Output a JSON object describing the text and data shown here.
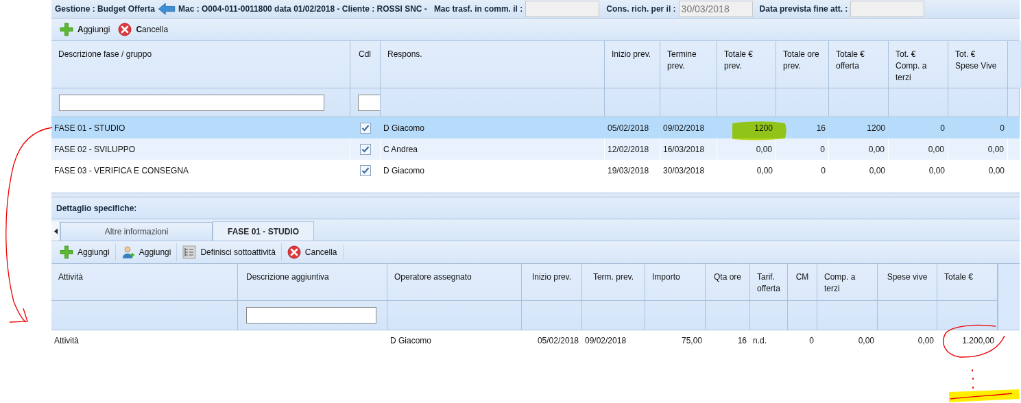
{
  "header": {
    "title": "Gestione : Budget Offerta",
    "info": "Mac : O004-011-0011800 data 01/02/2018 - Cliente : ROSSI SNC -",
    "fields": [
      {
        "label": "Mac trasf. in comm. il :"
      },
      {
        "label": "Cons. rich. per il :",
        "value": "30/03/2018"
      },
      {
        "label": "Data prevista fine att. :"
      }
    ]
  },
  "toolbar": [
    {
      "kind": "add",
      "label": "**A**ggiungi"
    },
    {
      "kind": "delete",
      "label": "**C**ancella"
    }
  ],
  "phases": {
    "columns": [
      {
        "label": "Descrizione fase / gruppo",
        "filter": true
      },
      {
        "label": "Cdl",
        "filter": true
      },
      {
        "label": "Respons."
      },
      {
        "label": "Inizio prev."
      },
      {
        "label": "Termine prev."
      },
      {
        "label": "Totale € prev."
      },
      {
        "label": "Totale ore prev."
      },
      {
        "label": "Totale € offerta"
      },
      {
        "label": "Tot. € Comp. a terzi"
      },
      {
        "label": "Tot. € Spese Vive"
      }
    ],
    "rows": [
      {
        "selected": true,
        "cells": [
          "FASE 01 - STUDIO",
          {
            "checked": true
          },
          "D Giacomo",
          "05/02/2018",
          "09/02/2018",
          "1200",
          "16",
          "1200",
          "0",
          "0"
        ]
      },
      {
        "selected": false,
        "cells": [
          "FASE 02 - SVILUPPO",
          {
            "checked": true
          },
          "C Andrea",
          "12/02/2018",
          "16/03/2018",
          "0,00",
          "0",
          "0,00",
          "0,00",
          "0,00"
        ]
      },
      {
        "selected": false,
        "cells": [
          "FASE 03 - VERIFICA E CONSEGNA",
          {
            "checked": true
          },
          "D Giacomo",
          "19/03/2018",
          "30/03/2018",
          "0,00",
          "0",
          "0,00",
          "0,00",
          "0,00"
        ]
      }
    ]
  },
  "detail": {
    "title": "Dettaglio specifiche:",
    "tabs": [
      {
        "label": "Altre informazioni",
        "selected": false
      },
      {
        "label": "FASE 01 - STUDIO",
        "selected": true
      }
    ],
    "toolbar": [
      {
        "kind": "add",
        "label": "Aggiungi"
      },
      {
        "kind": "user-add",
        "label": "Aggiungi"
      },
      {
        "kind": "subtasks",
        "label": "Definisci sottoattività"
      },
      {
        "kind": "delete",
        "label": "Cancella"
      }
    ],
    "columns": [
      {
        "label": "Attività"
      },
      {
        "label": "Descrizione aggiuntiva",
        "filter": true
      },
      {
        "label": "Operatore assegnato"
      },
      {
        "label": "Inizio prev."
      },
      {
        "label": "Term. prev."
      },
      {
        "label": "Importo"
      },
      {
        "label": "Qta ore"
      },
      {
        "label": "Tarif. offerta"
      },
      {
        "label": "CM"
      },
      {
        "label": "Comp. a terzi"
      },
      {
        "label": "Spese vive"
      },
      {
        "label": "Totale €"
      }
    ],
    "rows": [
      {
        "cells": [
          "Attività",
          "",
          "D Giacomo",
          "05/02/2018",
          "09/02/2018",
          "75,00",
          "16",
          "n.d.",
          "0",
          "0,00",
          "0,00",
          "1.200,00"
        ]
      }
    ]
  }
}
